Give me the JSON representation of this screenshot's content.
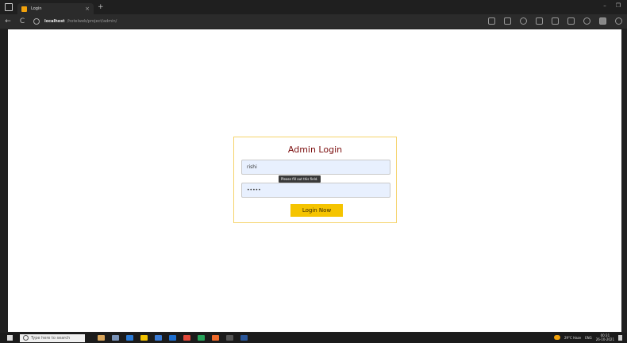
{
  "browser": {
    "tab_title": "Login",
    "tab_close": "×",
    "new_tab": "+",
    "window_controls": [
      "–",
      "❐"
    ],
    "url_host": "localhost",
    "url_path": "/hotelweb/project/admin/",
    "nav": {
      "back": "←",
      "refresh": "C"
    }
  },
  "login": {
    "title": "Admin Login",
    "username_value": "rishi",
    "password_value": "•••••",
    "tooltip": "Please fill out this field.",
    "button_label": "Login Now"
  },
  "taskbar": {
    "search_placeholder": "Type here to search",
    "weather": "29°C Haze",
    "language": "ENG",
    "time": "00:31",
    "date": "26-10-2021"
  },
  "colors": {
    "title_color": "#7a0c0c",
    "button_color": "#f5c400",
    "card_border": "#f5d36b",
    "field_background": "#e8f0fe"
  }
}
